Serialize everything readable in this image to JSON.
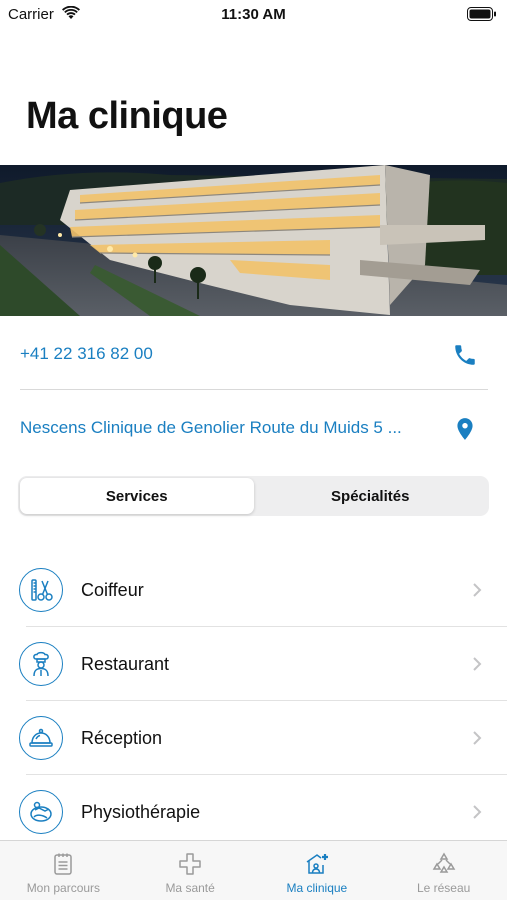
{
  "status_bar": {
    "carrier": "Carrier",
    "time": "11:30 AM"
  },
  "page": {
    "title": "Ma clinique"
  },
  "contact": {
    "phone": "+41 22 316 82 00",
    "address": "Nescens Clinique de Genolier Route du Muids 5 ..."
  },
  "segmented": {
    "tabs": [
      {
        "label": "Services",
        "active": true
      },
      {
        "label": "Spécialités",
        "active": false
      }
    ]
  },
  "services": [
    {
      "label": "Coiffeur",
      "icon": "scissors-comb-icon"
    },
    {
      "label": "Restaurant",
      "icon": "chef-icon"
    },
    {
      "label": "Réception",
      "icon": "service-bell-icon"
    },
    {
      "label": "Physiothérapie",
      "icon": "physio-icon"
    }
  ],
  "tab_bar": {
    "items": [
      {
        "label": "Mon parcours",
        "icon": "notepad-icon",
        "active": false
      },
      {
        "label": "Ma santé",
        "icon": "medical-cross-icon",
        "active": false
      },
      {
        "label": "Ma clinique",
        "icon": "clinic-icon",
        "active": true
      },
      {
        "label": "Le réseau",
        "icon": "network-icon",
        "active": false
      }
    ]
  },
  "colors": {
    "accent": "#1a7fc1",
    "inactive_tab": "#9a9a9a"
  }
}
